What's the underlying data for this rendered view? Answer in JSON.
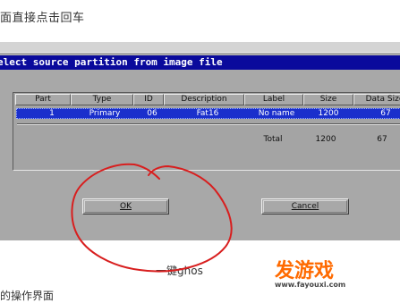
{
  "article": {
    "top_text": "面直接点击回车",
    "caption": "一键ghos",
    "bottom_text": "的操作界面"
  },
  "dialog": {
    "title": "elect source partition from image file",
    "columns": [
      "Part",
      "Type",
      "ID",
      "Description",
      "Label",
      "Size",
      "Data Size"
    ],
    "rows": [
      {
        "part": "1",
        "type": "Primary",
        "id": "06",
        "description": "Fat16",
        "label": "No name",
        "size": "1200",
        "data_size": "67"
      }
    ],
    "total_label": "Total",
    "total_size": "1200",
    "total_data_size": "67",
    "ok_label": "OK",
    "cancel_label": "Cancel"
  },
  "watermark": {
    "logo_text": "发游戏",
    "url": "www.fayouxi.com"
  },
  "colors": {
    "titlebar_bg": "#0a0a9c",
    "selection_bg": "#1a2fcc",
    "dialog_bg": "#a8a8a8",
    "annotation_red": "#d81e1e",
    "logo_orange": "#ff6a00"
  }
}
